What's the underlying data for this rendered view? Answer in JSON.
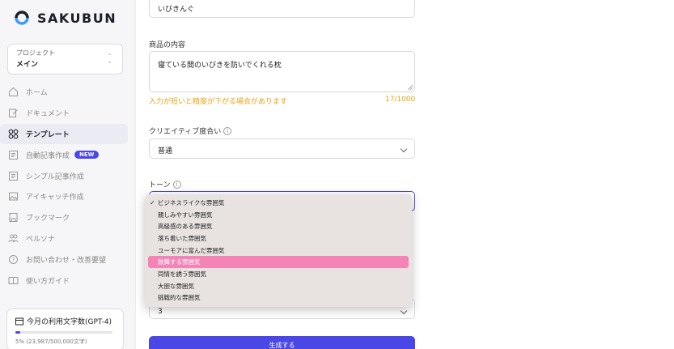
{
  "brand": {
    "name": "SAKUBUN"
  },
  "project": {
    "label": "プロジェクト",
    "value": "メイン"
  },
  "nav": [
    {
      "label": "ホーム",
      "icon": "home-icon"
    },
    {
      "label": "ドキュメント",
      "icon": "document-edit-icon"
    },
    {
      "label": "テンプレート",
      "icon": "grid-icon"
    },
    {
      "label": "自動記事作成",
      "icon": "article-icon",
      "badge": "NEW"
    },
    {
      "label": "シンプル記事作成",
      "icon": "article-icon"
    },
    {
      "label": "アイキャッチ作成",
      "icon": "image-icon"
    },
    {
      "label": "ブックマーク",
      "icon": "bookmark-icon"
    },
    {
      "label": "ペルソナ",
      "icon": "persona-icon"
    },
    {
      "label": "お問い合わせ・改善要望",
      "icon": "help-icon"
    },
    {
      "label": "使い方ガイド",
      "icon": "book-icon"
    }
  ],
  "usage": {
    "title": "今月の利用文字数(GPT-4)",
    "detail": "5% (23,987/500,000文字)",
    "progress": 0.05
  },
  "form": {
    "product_name_value": "いびきんぐ",
    "content_label": "商品の内容",
    "content_value": "寝ている間のいびきを防いでくれる枕",
    "warning": "入力が短いと精度が下がる場合があります",
    "counter": "17/1000",
    "creativity_label": "クリエイティブ度合い",
    "creativity_value": "普通",
    "tone_label": "トーン",
    "count_value": "3",
    "generate_label": "生成する"
  },
  "tone_options": [
    "ビジネスライクな雰囲気",
    "親しみやすい雰囲気",
    "高級感のある雰囲気",
    "落ち着いた雰囲気",
    "ユーモアに富んだ雰囲気",
    "鼓舞する雰囲気",
    "同情を誘う雰囲気",
    "大胆な雰囲気",
    "挑戦的な雰囲気"
  ],
  "tone_selected": "ビジネスライクな雰囲気",
  "tone_highlighted": "鼓舞する雰囲気",
  "colors": {
    "accent": "#4a47e6",
    "warning": "#e8a317",
    "highlight": "#f483b6"
  }
}
